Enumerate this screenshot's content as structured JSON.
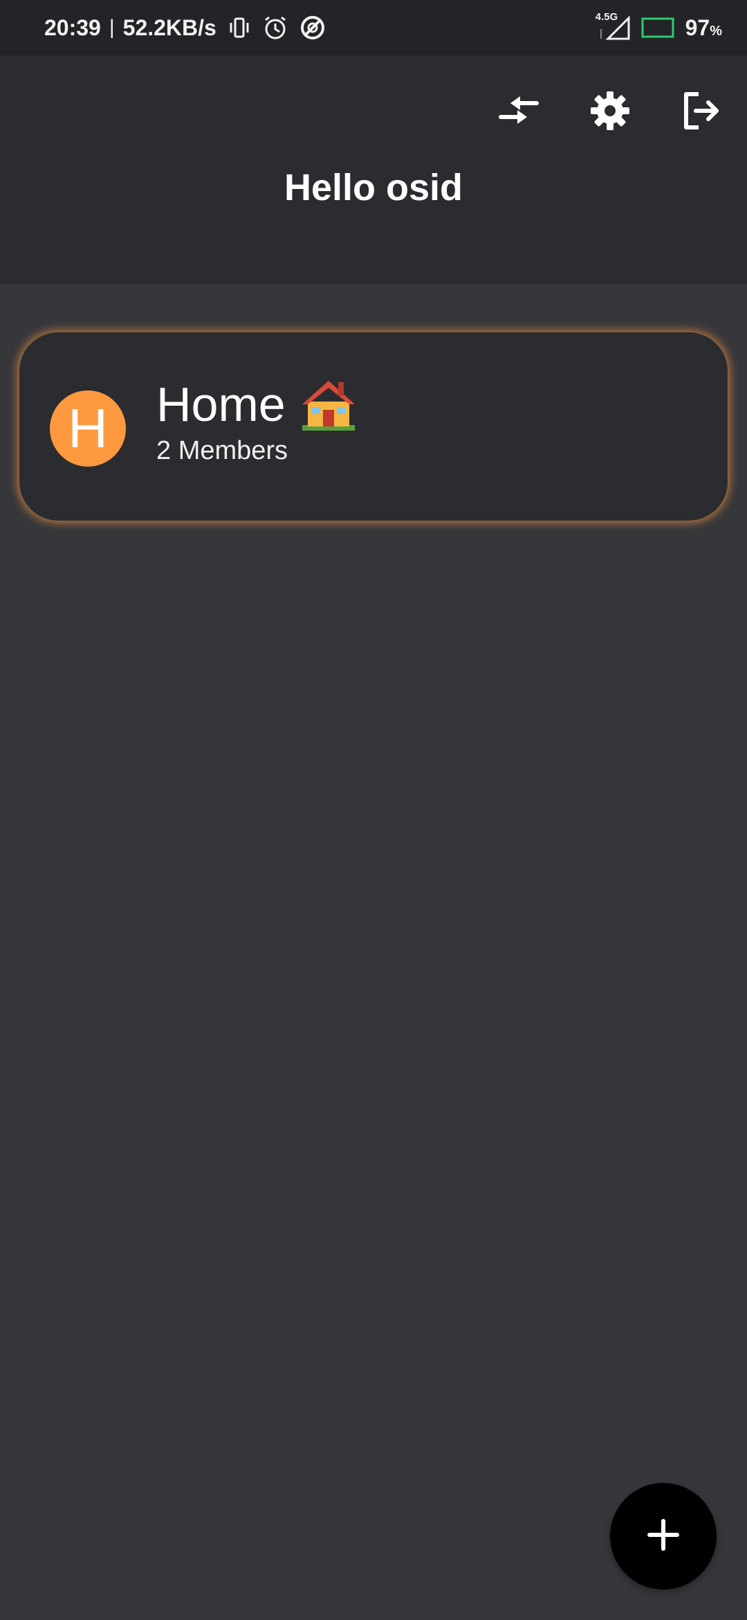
{
  "status_bar": {
    "time": "20:39",
    "separator": "|",
    "net_speed": "52.2KB/s",
    "network_type": "4.5G",
    "battery_percent": "97",
    "battery_unit": "%",
    "icons": [
      "vibrate-icon",
      "alarm-icon",
      "data-saver-icon",
      "signal-icon",
      "battery-icon"
    ]
  },
  "app_bar": {
    "title": "Hello osid",
    "actions": [
      "switch-icon",
      "gear-icon",
      "logout-icon"
    ]
  },
  "groups": [
    {
      "avatar_letter": "H",
      "name": "Home",
      "emoji": "🏠",
      "members": "2 Members"
    }
  ],
  "colors": {
    "background": "#36373b",
    "app_bar": "#2b2c30",
    "status_bar": "#232427",
    "accent": "#ff9940",
    "battery_outline": "#2ecc71",
    "fab": "#000000"
  },
  "fab": {
    "icon": "plus-icon"
  }
}
